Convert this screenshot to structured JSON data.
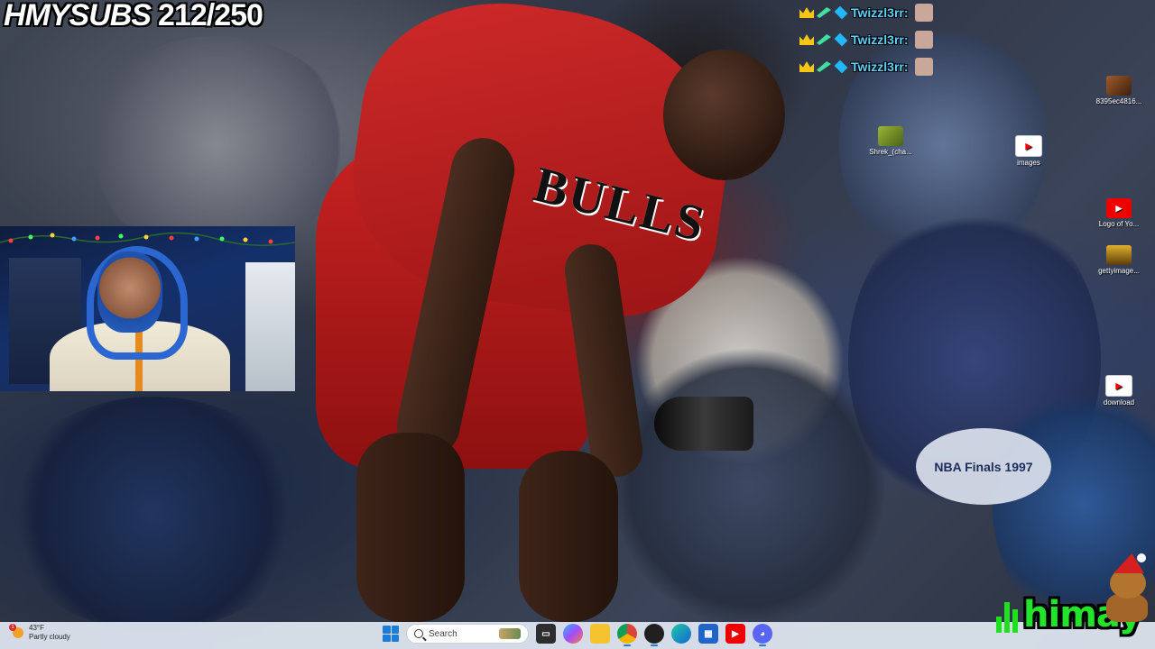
{
  "overlay": {
    "sub_label": "HMYSUBS",
    "sub_count": "212/250"
  },
  "chat": {
    "messages": [
      {
        "user": "Twizzl3rr:"
      },
      {
        "user": "Twizzl3rr:"
      },
      {
        "user": "Twizzl3rr:"
      }
    ]
  },
  "scene": {
    "jersey_text": "BULLS",
    "finals_text": "NBA Finals 1997"
  },
  "desktop_icons": [
    {
      "label": "8395ec4816...",
      "icon": "image-file-icon"
    },
    {
      "label": "Shrek_(cha...",
      "icon": "shrek-icon"
    },
    {
      "label": "images",
      "icon": "youtube-icon"
    },
    {
      "label": "Logo of Yo...",
      "icon": "youtube-icon"
    },
    {
      "label": "gettyimage...",
      "icon": "image-file-icon"
    },
    {
      "label": "download",
      "icon": "youtube-icon"
    }
  ],
  "taskbar": {
    "weather_temp": "43°F",
    "weather_desc": "Partly cloudy",
    "weather_alert": "1",
    "search_placeholder": "Search",
    "apps": [
      {
        "name": "task-view"
      },
      {
        "name": "copilot"
      },
      {
        "name": "file-explorer"
      },
      {
        "name": "chrome"
      },
      {
        "name": "obs"
      },
      {
        "name": "edge"
      },
      {
        "name": "store"
      },
      {
        "name": "youtube"
      },
      {
        "name": "discord"
      }
    ]
  },
  "brand": {
    "name": "himay"
  },
  "colors": {
    "chat_username": "#5ed2ff",
    "brand_green": "#22e42a",
    "taskbar_bg": "#e1e8f2"
  }
}
